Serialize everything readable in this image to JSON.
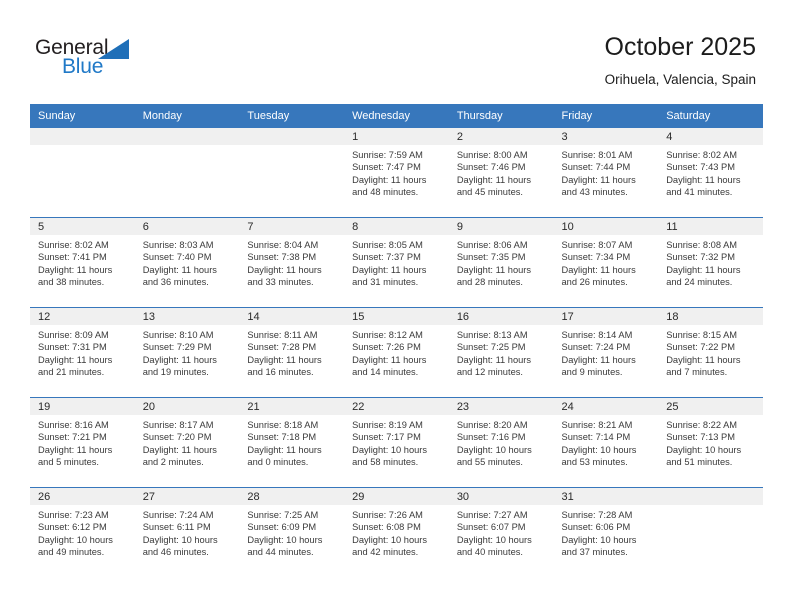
{
  "brand": {
    "name_top": "General",
    "name_bottom": "Blue",
    "triangle_color": "#1f6fb8",
    "blue_text_color": "#2079c7",
    "dark_text_color": "#231f20"
  },
  "header": {
    "title": "October 2025",
    "subtitle": "Orihuela, Valencia, Spain"
  },
  "theme": {
    "header_bg": "#3777bc",
    "header_text": "#ffffff",
    "daynum_band_bg": "#f0f0f0",
    "row_divider": "#3777bc",
    "cell_bg": "#ffffff",
    "body_text": "#3a3a3a"
  },
  "calendar": {
    "weekday_headers": [
      "Sunday",
      "Monday",
      "Tuesday",
      "Wednesday",
      "Thursday",
      "Friday",
      "Saturday"
    ],
    "weeks": [
      [
        {
          "day": "",
          "sunrise": "",
          "sunset": "",
          "daylight_line1": "",
          "daylight_line2": ""
        },
        {
          "day": "",
          "sunrise": "",
          "sunset": "",
          "daylight_line1": "",
          "daylight_line2": ""
        },
        {
          "day": "",
          "sunrise": "",
          "sunset": "",
          "daylight_line1": "",
          "daylight_line2": ""
        },
        {
          "day": "1",
          "sunrise": "Sunrise: 7:59 AM",
          "sunset": "Sunset: 7:47 PM",
          "daylight_line1": "Daylight: 11 hours",
          "daylight_line2": "and 48 minutes."
        },
        {
          "day": "2",
          "sunrise": "Sunrise: 8:00 AM",
          "sunset": "Sunset: 7:46 PM",
          "daylight_line1": "Daylight: 11 hours",
          "daylight_line2": "and 45 minutes."
        },
        {
          "day": "3",
          "sunrise": "Sunrise: 8:01 AM",
          "sunset": "Sunset: 7:44 PM",
          "daylight_line1": "Daylight: 11 hours",
          "daylight_line2": "and 43 minutes."
        },
        {
          "day": "4",
          "sunrise": "Sunrise: 8:02 AM",
          "sunset": "Sunset: 7:43 PM",
          "daylight_line1": "Daylight: 11 hours",
          "daylight_line2": "and 41 minutes."
        }
      ],
      [
        {
          "day": "5",
          "sunrise": "Sunrise: 8:02 AM",
          "sunset": "Sunset: 7:41 PM",
          "daylight_line1": "Daylight: 11 hours",
          "daylight_line2": "and 38 minutes."
        },
        {
          "day": "6",
          "sunrise": "Sunrise: 8:03 AM",
          "sunset": "Sunset: 7:40 PM",
          "daylight_line1": "Daylight: 11 hours",
          "daylight_line2": "and 36 minutes."
        },
        {
          "day": "7",
          "sunrise": "Sunrise: 8:04 AM",
          "sunset": "Sunset: 7:38 PM",
          "daylight_line1": "Daylight: 11 hours",
          "daylight_line2": "and 33 minutes."
        },
        {
          "day": "8",
          "sunrise": "Sunrise: 8:05 AM",
          "sunset": "Sunset: 7:37 PM",
          "daylight_line1": "Daylight: 11 hours",
          "daylight_line2": "and 31 minutes."
        },
        {
          "day": "9",
          "sunrise": "Sunrise: 8:06 AM",
          "sunset": "Sunset: 7:35 PM",
          "daylight_line1": "Daylight: 11 hours",
          "daylight_line2": "and 28 minutes."
        },
        {
          "day": "10",
          "sunrise": "Sunrise: 8:07 AM",
          "sunset": "Sunset: 7:34 PM",
          "daylight_line1": "Daylight: 11 hours",
          "daylight_line2": "and 26 minutes."
        },
        {
          "day": "11",
          "sunrise": "Sunrise: 8:08 AM",
          "sunset": "Sunset: 7:32 PM",
          "daylight_line1": "Daylight: 11 hours",
          "daylight_line2": "and 24 minutes."
        }
      ],
      [
        {
          "day": "12",
          "sunrise": "Sunrise: 8:09 AM",
          "sunset": "Sunset: 7:31 PM",
          "daylight_line1": "Daylight: 11 hours",
          "daylight_line2": "and 21 minutes."
        },
        {
          "day": "13",
          "sunrise": "Sunrise: 8:10 AM",
          "sunset": "Sunset: 7:29 PM",
          "daylight_line1": "Daylight: 11 hours",
          "daylight_line2": "and 19 minutes."
        },
        {
          "day": "14",
          "sunrise": "Sunrise: 8:11 AM",
          "sunset": "Sunset: 7:28 PM",
          "daylight_line1": "Daylight: 11 hours",
          "daylight_line2": "and 16 minutes."
        },
        {
          "day": "15",
          "sunrise": "Sunrise: 8:12 AM",
          "sunset": "Sunset: 7:26 PM",
          "daylight_line1": "Daylight: 11 hours",
          "daylight_line2": "and 14 minutes."
        },
        {
          "day": "16",
          "sunrise": "Sunrise: 8:13 AM",
          "sunset": "Sunset: 7:25 PM",
          "daylight_line1": "Daylight: 11 hours",
          "daylight_line2": "and 12 minutes."
        },
        {
          "day": "17",
          "sunrise": "Sunrise: 8:14 AM",
          "sunset": "Sunset: 7:24 PM",
          "daylight_line1": "Daylight: 11 hours",
          "daylight_line2": "and 9 minutes."
        },
        {
          "day": "18",
          "sunrise": "Sunrise: 8:15 AM",
          "sunset": "Sunset: 7:22 PM",
          "daylight_line1": "Daylight: 11 hours",
          "daylight_line2": "and 7 minutes."
        }
      ],
      [
        {
          "day": "19",
          "sunrise": "Sunrise: 8:16 AM",
          "sunset": "Sunset: 7:21 PM",
          "daylight_line1": "Daylight: 11 hours",
          "daylight_line2": "and 5 minutes."
        },
        {
          "day": "20",
          "sunrise": "Sunrise: 8:17 AM",
          "sunset": "Sunset: 7:20 PM",
          "daylight_line1": "Daylight: 11 hours",
          "daylight_line2": "and 2 minutes."
        },
        {
          "day": "21",
          "sunrise": "Sunrise: 8:18 AM",
          "sunset": "Sunset: 7:18 PM",
          "daylight_line1": "Daylight: 11 hours",
          "daylight_line2": "and 0 minutes."
        },
        {
          "day": "22",
          "sunrise": "Sunrise: 8:19 AM",
          "sunset": "Sunset: 7:17 PM",
          "daylight_line1": "Daylight: 10 hours",
          "daylight_line2": "and 58 minutes."
        },
        {
          "day": "23",
          "sunrise": "Sunrise: 8:20 AM",
          "sunset": "Sunset: 7:16 PM",
          "daylight_line1": "Daylight: 10 hours",
          "daylight_line2": "and 55 minutes."
        },
        {
          "day": "24",
          "sunrise": "Sunrise: 8:21 AM",
          "sunset": "Sunset: 7:14 PM",
          "daylight_line1": "Daylight: 10 hours",
          "daylight_line2": "and 53 minutes."
        },
        {
          "day": "25",
          "sunrise": "Sunrise: 8:22 AM",
          "sunset": "Sunset: 7:13 PM",
          "daylight_line1": "Daylight: 10 hours",
          "daylight_line2": "and 51 minutes."
        }
      ],
      [
        {
          "day": "26",
          "sunrise": "Sunrise: 7:23 AM",
          "sunset": "Sunset: 6:12 PM",
          "daylight_line1": "Daylight: 10 hours",
          "daylight_line2": "and 49 minutes."
        },
        {
          "day": "27",
          "sunrise": "Sunrise: 7:24 AM",
          "sunset": "Sunset: 6:11 PM",
          "daylight_line1": "Daylight: 10 hours",
          "daylight_line2": "and 46 minutes."
        },
        {
          "day": "28",
          "sunrise": "Sunrise: 7:25 AM",
          "sunset": "Sunset: 6:09 PM",
          "daylight_line1": "Daylight: 10 hours",
          "daylight_line2": "and 44 minutes."
        },
        {
          "day": "29",
          "sunrise": "Sunrise: 7:26 AM",
          "sunset": "Sunset: 6:08 PM",
          "daylight_line1": "Daylight: 10 hours",
          "daylight_line2": "and 42 minutes."
        },
        {
          "day": "30",
          "sunrise": "Sunrise: 7:27 AM",
          "sunset": "Sunset: 6:07 PM",
          "daylight_line1": "Daylight: 10 hours",
          "daylight_line2": "and 40 minutes."
        },
        {
          "day": "31",
          "sunrise": "Sunrise: 7:28 AM",
          "sunset": "Sunset: 6:06 PM",
          "daylight_line1": "Daylight: 10 hours",
          "daylight_line2": "and 37 minutes."
        },
        {
          "day": "",
          "sunrise": "",
          "sunset": "",
          "daylight_line1": "",
          "daylight_line2": ""
        }
      ]
    ]
  }
}
